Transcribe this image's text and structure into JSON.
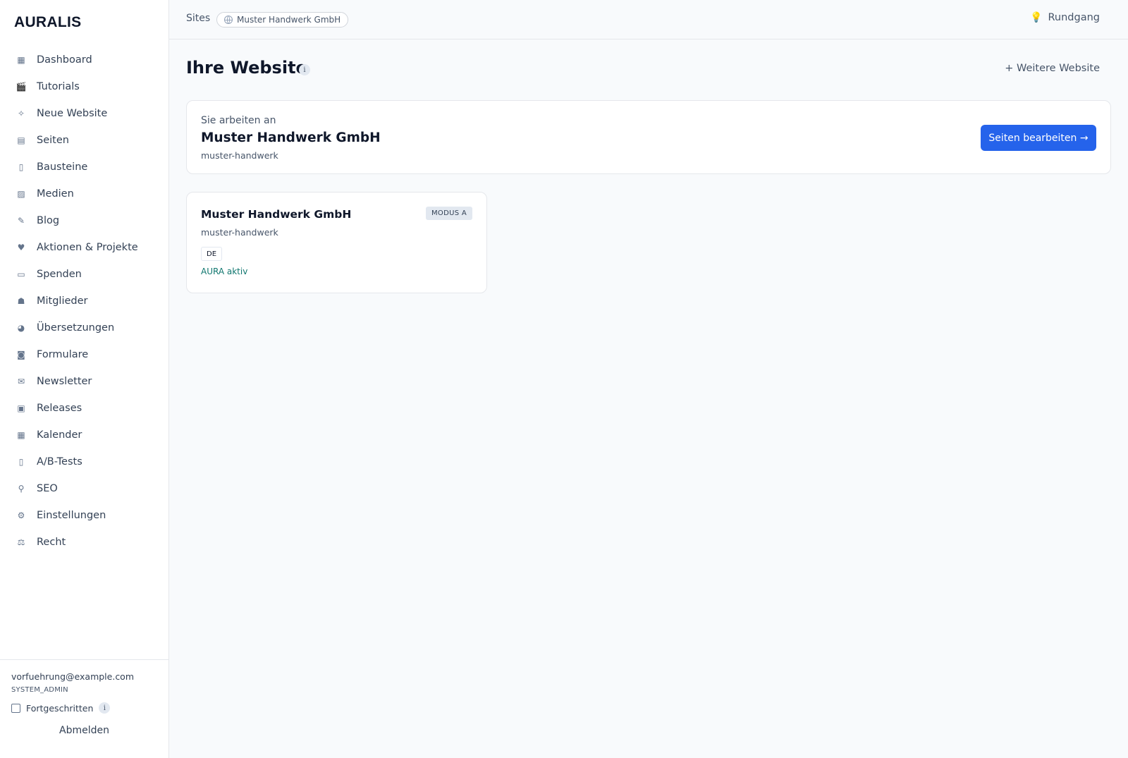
{
  "brand": "AURALIS",
  "sidebar": {
    "items": [
      {
        "label": "Dashboard",
        "icon": "▦",
        "icon_name": "dashboard-icon"
      },
      {
        "label": "Tutorials",
        "icon": "🎬",
        "icon_name": "clapper-icon"
      },
      {
        "label": "Neue Website",
        "icon": "✧",
        "icon_name": "sparkle-icon"
      },
      {
        "label": "Seiten",
        "icon": "▤",
        "icon_name": "page-icon"
      },
      {
        "label": "Bausteine",
        "icon": "▯",
        "icon_name": "block-icon"
      },
      {
        "label": "Medien",
        "icon": "▨",
        "icon_name": "image-icon"
      },
      {
        "label": "Blog",
        "icon": "✎",
        "icon_name": "pen-icon"
      },
      {
        "label": "Aktionen & Projekte",
        "icon": "♥",
        "icon_name": "heart-icon"
      },
      {
        "label": "Spenden",
        "icon": "▭",
        "icon_name": "donation-icon"
      },
      {
        "label": "Mitglieder",
        "icon": "☗",
        "icon_name": "members-icon"
      },
      {
        "label": "Übersetzungen",
        "icon": "◕",
        "icon_name": "globe-icon"
      },
      {
        "label": "Formulare",
        "icon": "◙",
        "icon_name": "form-icon"
      },
      {
        "label": "Newsletter",
        "icon": "✉",
        "icon_name": "mail-icon"
      },
      {
        "label": "Releases",
        "icon": "▣",
        "icon_name": "package-icon"
      },
      {
        "label": "Kalender",
        "icon": "▦",
        "icon_name": "calendar-icon"
      },
      {
        "label": "A/B-Tests",
        "icon": "▯",
        "icon_name": "ab-test-icon"
      },
      {
        "label": "SEO",
        "icon": "⚲",
        "icon_name": "magnifier-icon"
      },
      {
        "label": "Einstellungen",
        "icon": "⚙",
        "icon_name": "gear-icon"
      },
      {
        "label": "Recht",
        "icon": "⚖",
        "icon_name": "scales-icon"
      }
    ],
    "footer": {
      "email": "vorfuehrung@example.com",
      "role": "SYSTEM_ADMIN",
      "advanced_label": "Fortgeschritten",
      "info": "i",
      "logout": "Abmelden"
    }
  },
  "topbar": {
    "crumb_root": "Sites",
    "crumb_site": "Muster Handwerk GmbH",
    "tour": "Rundgang"
  },
  "main": {
    "title": "Ihre Website",
    "title_info": "i",
    "more_site": "+ Weitere Website",
    "current": {
      "label": "Sie arbeiten an",
      "name": "Muster Handwerk GmbH",
      "slug": "muster-handwerk",
      "edit_button": "Seiten bearbeiten →"
    },
    "site_card": {
      "name": "Muster Handwerk GmbH",
      "mode": "MODUS A",
      "slug": "muster-handwerk",
      "lang": "DE",
      "aura": "AURA aktiv"
    }
  },
  "colors": {
    "primary": "#2563eb",
    "accent_teal": "#0f766e",
    "background": "#f8fafc"
  }
}
